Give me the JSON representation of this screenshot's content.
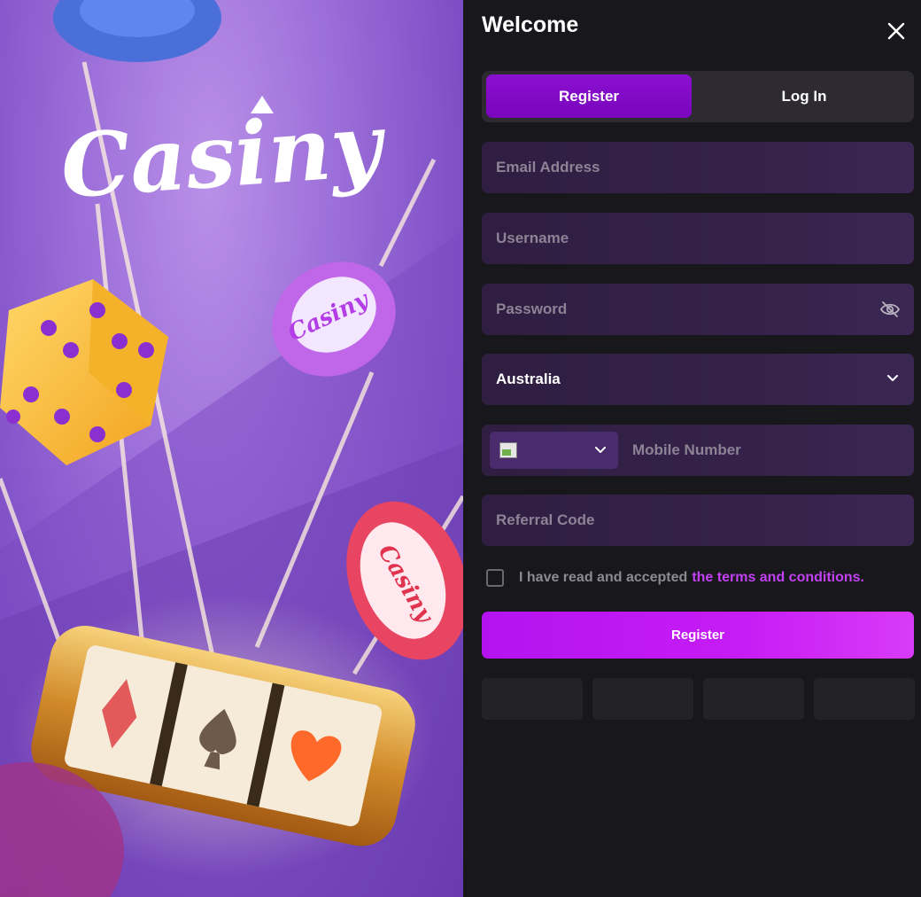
{
  "promo": {
    "brand": "Casiny",
    "chip_logo": "Casiny"
  },
  "dialog": {
    "title": "Welcome",
    "close_icon": "close-icon"
  },
  "tabs": [
    {
      "label": "Register",
      "active": true
    },
    {
      "label": "Log In",
      "active": false
    }
  ],
  "form": {
    "email": {
      "placeholder": "Email Address",
      "value": ""
    },
    "username": {
      "placeholder": "Username",
      "value": ""
    },
    "password": {
      "placeholder": "Password",
      "value": "",
      "icon": "eye-slash-icon"
    },
    "country": {
      "selected": "Australia",
      "icon": "chevron-down-icon"
    },
    "mobile": {
      "placeholder": "Mobile Number",
      "value": "",
      "code_icon": "chevron-down-icon"
    },
    "referral": {
      "placeholder": "Referral Code",
      "value": ""
    },
    "terms": {
      "checked": false,
      "text": "I have read and accepted",
      "link": "the terms and conditions."
    },
    "submit_label": "Register"
  },
  "social_buttons": [
    "",
    "",
    "",
    ""
  ],
  "colors": {
    "accent": "#c341f4",
    "tab_active": "#7a06bd",
    "panel_bg": "#18171b",
    "field_bg": "#34224a"
  }
}
